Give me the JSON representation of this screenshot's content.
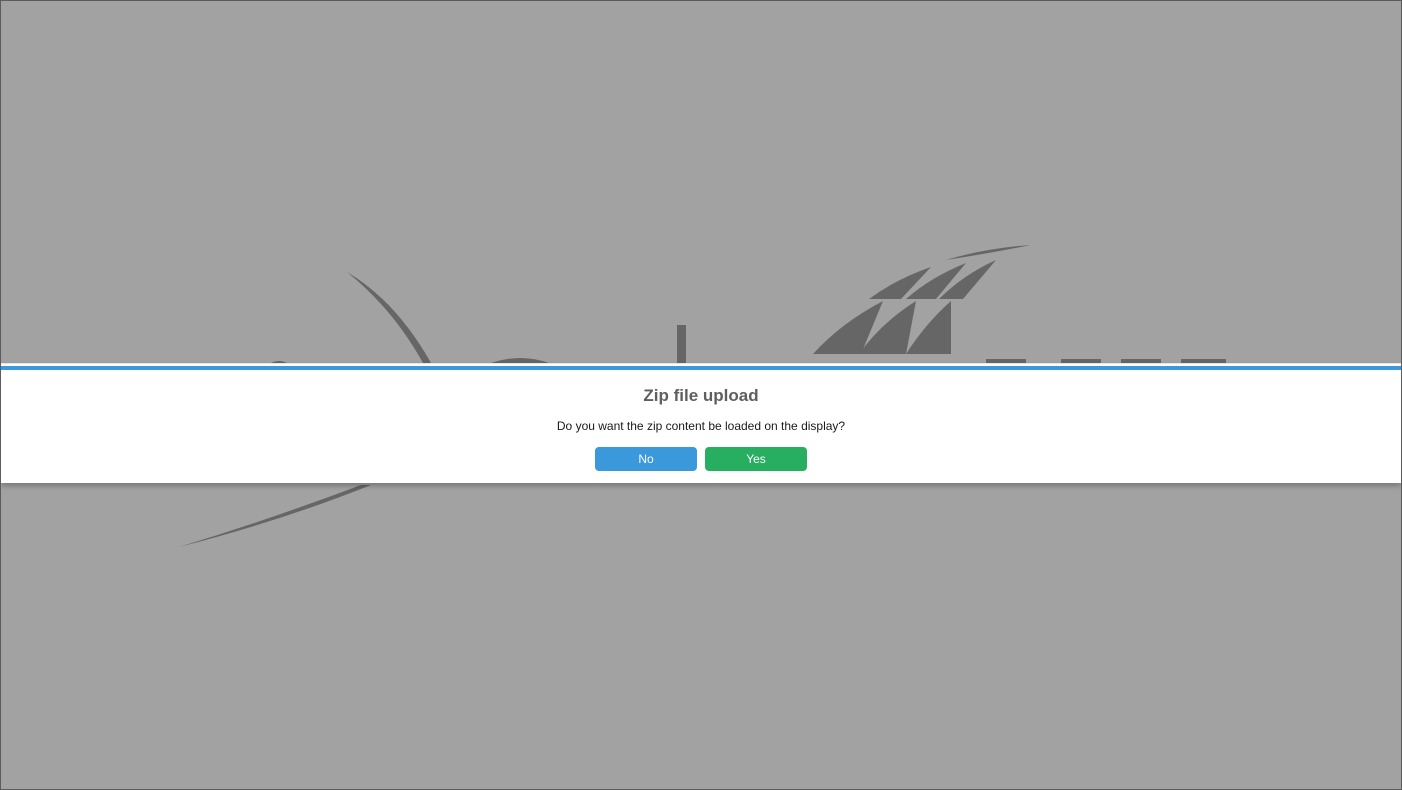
{
  "dialog": {
    "title": "Zip file upload",
    "message": "Do you want the zip content be loaded on the display?",
    "no_label": "No",
    "yes_label": "Yes"
  },
  "colors": {
    "backdrop": "#a2a2a2",
    "logo": "#666666",
    "accent": "#3a98db",
    "no_button": "#3a98db",
    "yes_button": "#27ae60"
  },
  "background": {
    "logo_icon": "sail-ship-logo-icon"
  }
}
